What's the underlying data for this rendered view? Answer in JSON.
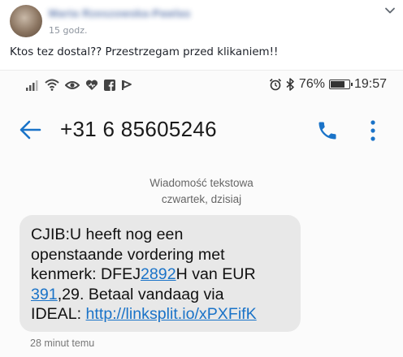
{
  "post": {
    "author": "Marta Rzeszowska-Pawlas",
    "time": "15 godz.",
    "text": "Ktos tez dostal?? Przestrzegam przed klikaniem!!"
  },
  "status_bar": {
    "left_icons": [
      "signal-icon",
      "wifi-icon",
      "eye-icon",
      "heart-icon",
      "facebook-icon",
      "flag-icon"
    ],
    "right_icons": [
      "alarm-icon",
      "bluetooth-icon"
    ],
    "battery_percent_label": "76%",
    "battery_level": 0.76,
    "time": "19:57"
  },
  "appbar": {
    "contact": "+31 6 85605246"
  },
  "thread": {
    "message_type": "Wiadomość tekstowa",
    "day": "czwartek, dzisiaj",
    "message": {
      "l1": "CJIB:U heeft nog een",
      "l2": "openstaande vordering met",
      "l3_prefix": "kenmerk: DFEJ",
      "l3_link": "2892",
      "l3_suffix": "H van EUR",
      "l4_link": "391",
      "l4_suffix": ",29.  Betaal vandaag via",
      "l5_prefix": "IDEAL: ",
      "l5_link": "http://linksplit.io/xPXFifK"
    },
    "message_time": "28 minut temu"
  },
  "colors": {
    "accent_blue": "#1a73c8",
    "link_blue": "#1a73c8",
    "bubble_gray": "#e8e8e8"
  }
}
